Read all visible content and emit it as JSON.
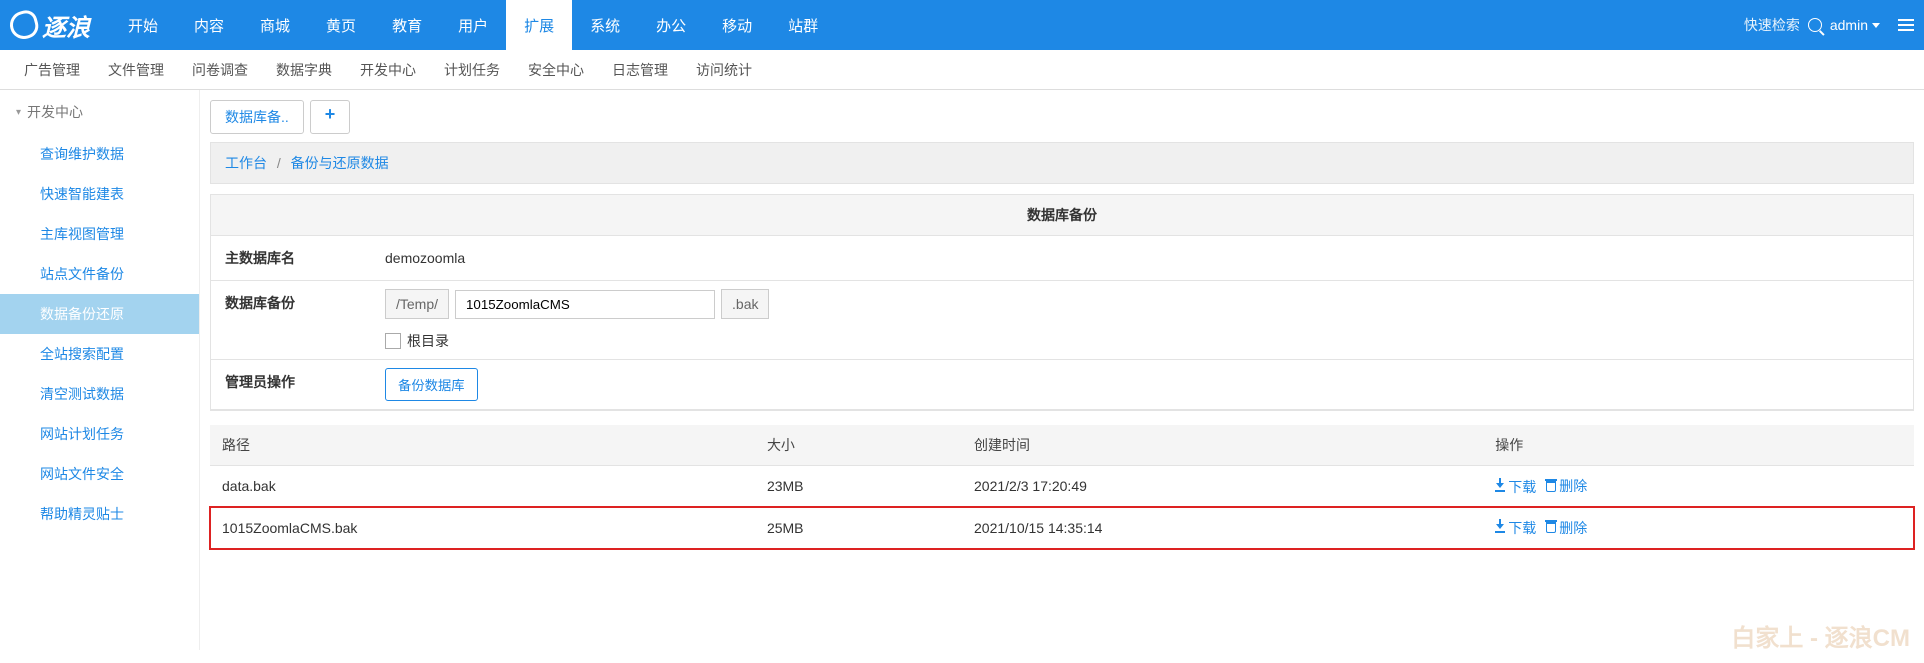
{
  "top": {
    "logo_text": "逐浪",
    "nav": [
      "开始",
      "内容",
      "商城",
      "黄页",
      "教育",
      "用户",
      "扩展",
      "系统",
      "办公",
      "移动",
      "站群"
    ],
    "nav_active_index": 6,
    "search_label": "快速检索",
    "user": "admin"
  },
  "subnav": [
    "广告管理",
    "文件管理",
    "问卷调查",
    "数据字典",
    "开发中心",
    "计划任务",
    "安全中心",
    "日志管理",
    "访问统计"
  ],
  "sidebar": {
    "header": "开发中心",
    "items": [
      "查询维护数据",
      "快速智能建表",
      "主库视图管理",
      "站点文件备份",
      "数据备份还原",
      "全站搜索配置",
      "清空测试数据",
      "网站计划任务",
      "网站文件安全",
      "帮助精灵贴士"
    ],
    "active_index": 4
  },
  "tabs": {
    "label": "数据库备..",
    "add": "+"
  },
  "breadcrumb": {
    "a": "工作台",
    "sep": "/",
    "b": "备份与还原数据"
  },
  "panel": {
    "title": "数据库备份",
    "rows": {
      "dbname_label": "主数据库名",
      "dbname_value": "demozoomla",
      "backup_label": "数据库备份",
      "path_prefix": "/Temp/",
      "filename": "1015ZoomlaCMS",
      "path_suffix": ".bak",
      "root_label": "根目录",
      "admin_label": "管理员操作",
      "backup_btn": "备份数据库"
    }
  },
  "grid": {
    "headers": [
      "路径",
      "大小",
      "创建时间",
      "操作"
    ],
    "rows": [
      {
        "path": "data.bak",
        "size": "23MB",
        "time": "2021/2/3 17:20:49",
        "dl": "下载",
        "del": "删除",
        "hl": false
      },
      {
        "path": "1015ZoomlaCMS.bak",
        "size": "25MB",
        "time": "2021/10/15 14:35:14",
        "dl": "下载",
        "del": "删除",
        "hl": true
      }
    ]
  },
  "watermark": "白家上 - 逐浪CM"
}
